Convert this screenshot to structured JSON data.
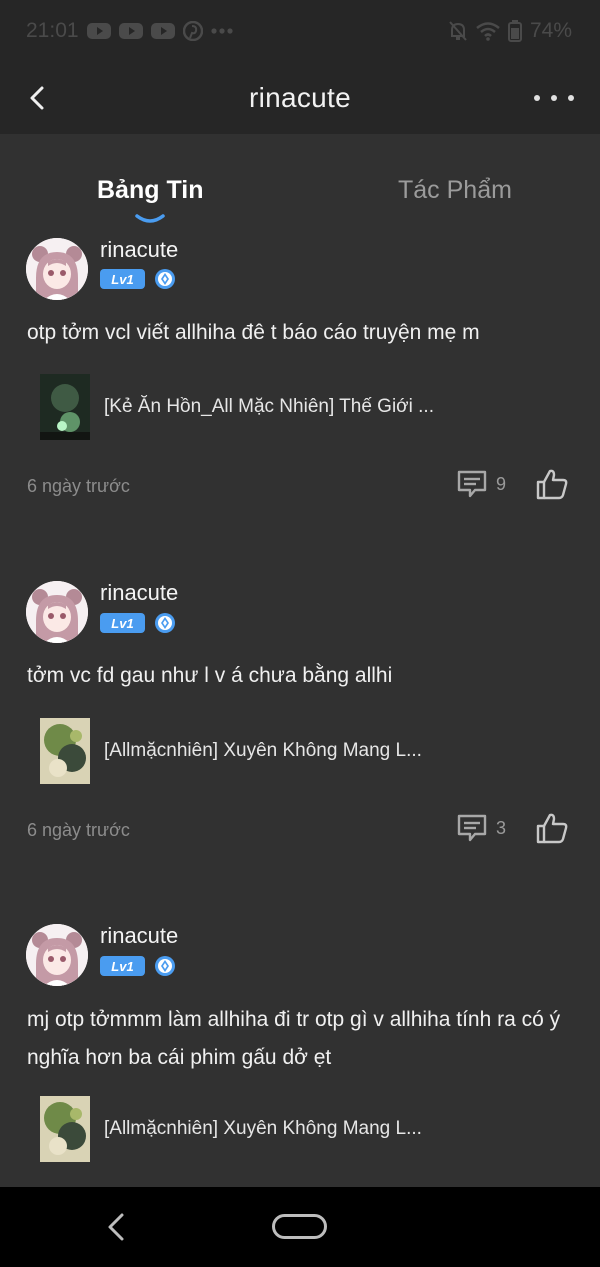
{
  "status_bar": {
    "time": "21:01",
    "battery": "74%",
    "icons": [
      "youtube-icon",
      "youtube-icon",
      "youtube-icon",
      "pinterest-icon",
      "more-notifications-icon",
      "mute-icon",
      "wifi-icon",
      "battery-icon"
    ]
  },
  "header": {
    "title": "rinacute",
    "back_icon": "chevron-left-icon",
    "more_icon": "more-horizontal-icon"
  },
  "tabs": [
    {
      "label": "Bảng Tin",
      "active": true
    },
    {
      "label": "Tác Phẩm",
      "active": false
    }
  ],
  "colors": {
    "background": "#313131",
    "header": "#262626",
    "accent_blue": "#4a9cf0",
    "muted_text": "#8c8c8c"
  },
  "posts": [
    {
      "author": "rinacute",
      "level": "Lv1",
      "text": "otp tởm vcl viết allhiha đê t báo cáo truyện mẹ m",
      "attachment_title": "[Kẻ Ăn Hồn_All Mặc Nhiên] Thế Giới ...",
      "timestamp": "6 ngày trước",
      "comments": "9"
    },
    {
      "author": "rinacute",
      "level": "Lv1",
      "text": "tởm vc fd gau như l v á chưa bằng allhi",
      "attachment_title": "[Allmặcnhiên] Xuyên Không Mang L...",
      "timestamp": "6 ngày trước",
      "comments": "3"
    },
    {
      "author": "rinacute",
      "level": "Lv1",
      "text": "mj otp tởmmm làm allhiha đi tr otp gì v allhiha tính ra có ý nghĩa hơn ba cái phim gấu dở ẹt",
      "attachment_title": "[Allmặcnhiên] Xuyên Không Mang L..."
    }
  ]
}
